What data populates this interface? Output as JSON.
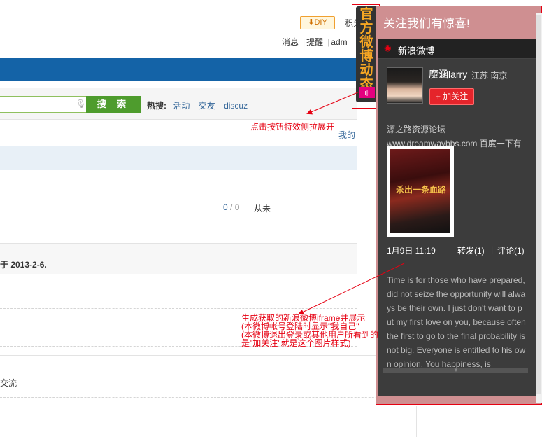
{
  "forum": {
    "diy": "DIY",
    "points_label": "积分",
    "nav": [
      "消息",
      "提醒",
      "adm"
    ],
    "search_button": "搜 索",
    "hot_label": "热搜:",
    "hot_links": [
      "活动",
      "交友",
      "discuz"
    ],
    "mine": "我的",
    "count_replies": "0",
    "count_views": "0",
    "last_post": "从未",
    "date_line": "于 2013-2-6.",
    "category_text": "交流"
  },
  "tab": {
    "text": "官方微博动态",
    "icon": "signal-icon"
  },
  "panel": {
    "header": "关注我们有惊喜!",
    "widget_title": "新浪微博",
    "user_name": "魔涵larry",
    "user_location": "江苏 南京",
    "follow_button": "+ 加关注",
    "post1_text": "源之路资源论坛www.dreamwaybbs.com 百度一下有惊喜哦! 】",
    "poster_text": "杀出一条血路",
    "post1_time": "1月9日 11:19",
    "post1_forward": "转发(1)",
    "post1_comment": "评论(1)",
    "post2_text": "Time is for those who have prepared, did not seize the opportunity will always be their own. I just don't want to put my first love on you, because often the first to go to the final probability is not big. Everyone is entitled to his own opinion. You happiness, is"
  },
  "annotations": {
    "a1": "点击按钮特效侧拉展开",
    "a2_line1": "生成获取的新浪微博iframe并展示",
    "a2_line2": "(本微博帐号登陆时显示\"我自己\"",
    "a2_line3": "(本微博退出登录或其他用户所看到的",
    "a2_line4": "是\"加关注\"就是这个图片样式)"
  },
  "colors": {
    "accent_red": "#e60012",
    "panel_bg": "#cf8f91",
    "weibo_dark": "#3c3c3c",
    "search_green": "#4e9c2d",
    "forum_blue": "#1463a7",
    "tab_text": "#f6a623"
  }
}
